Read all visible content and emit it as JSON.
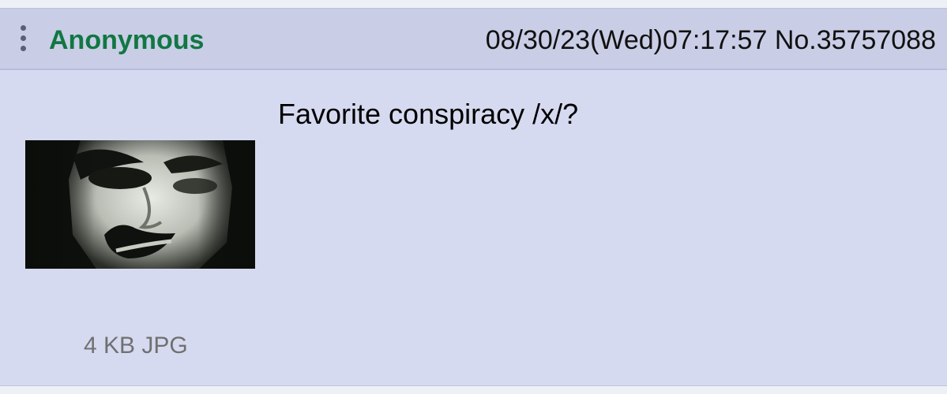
{
  "post": {
    "name": "Anonymous",
    "datetime": "08/30/23(Wed)07:17:57",
    "post_number": "No.35757088",
    "comment": "Favorite conspiracy /x/?",
    "file": {
      "info": "4 KB JPG"
    }
  },
  "icons": {
    "menu": "more-vert-icon"
  },
  "colors": {
    "post_bg": "#d6daf0",
    "header_bg": "#c9cde6",
    "name_color": "#117743",
    "page_bg": "#eef0f8"
  }
}
